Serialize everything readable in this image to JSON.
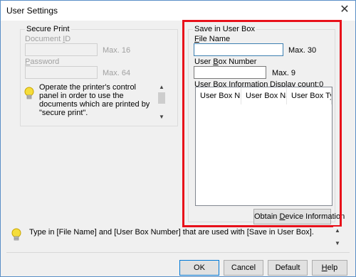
{
  "window": {
    "title": "User Settings",
    "close_glyph": "✕"
  },
  "secure_print": {
    "group_label": "Secure Print",
    "document_id_label": "Document ID",
    "document_id_value": "",
    "document_id_max": "Max. 16",
    "password_label": "Password",
    "password_value": "",
    "password_max": "Max. 64",
    "info_text": "Operate the printer's control panel in order to use the documents which are printed by \"secure print\"."
  },
  "save_in_user_box": {
    "group_label": "Save in User Box",
    "file_name_label": "File Name",
    "file_name_value": "",
    "file_name_max": "Max. 30",
    "user_box_number_label": "User Box Number",
    "user_box_number_value": "",
    "user_box_number_max": "Max. 9",
    "info_label": "User Box Information",
    "display_count": "Display count:0",
    "columns": [
      "User Box Nu...",
      "User Box Name",
      "User Box Type"
    ],
    "rows": [],
    "obtain_button": "Obtain Device Information"
  },
  "hint": {
    "text": "Type in [File Name] and [User Box Number] that are used with [Save in User Box]."
  },
  "buttons": {
    "ok": "OK",
    "cancel": "Cancel",
    "default": "Default",
    "help": "Help"
  },
  "icons": {
    "info": "lightbulb-icon",
    "close": "close-icon",
    "scroll_up": "chevron-up-icon",
    "scroll_down": "chevron-down-icon"
  },
  "colors": {
    "highlight": "#e8101a",
    "focus_border": "#3c7fb1",
    "default_button_border": "#0078d7"
  }
}
